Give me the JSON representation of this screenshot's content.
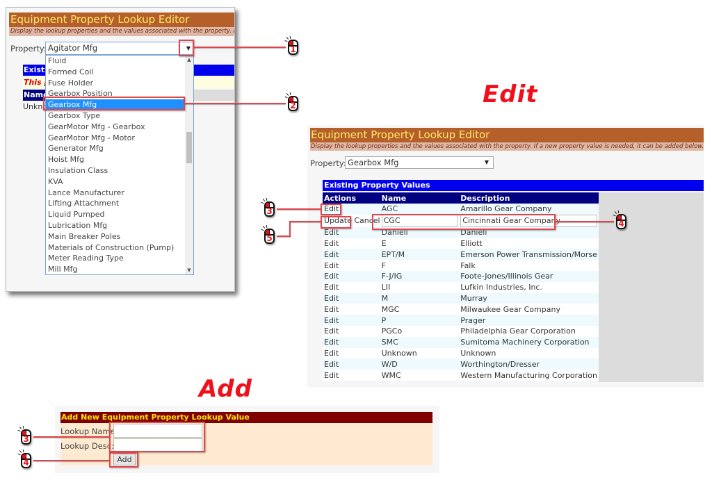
{
  "app": {
    "title": "Equipment Property Lookup Editor",
    "subtitle": "Display the lookup properties and the values associated with the property. If a new property value is needed, it can be added below.",
    "property_label": "Property:"
  },
  "labels": {
    "edit_heading": "Edit",
    "add_heading": "Add"
  },
  "dropdown_panel": {
    "selected_value": "Agitator Mfg",
    "dropdown_arrow": "▼",
    "bg_section_head": "Existing Property Values",
    "bg_warning": "This property has no values",
    "bg_name_header": "Name",
    "bg_first_value": "Unknown",
    "options": [
      "Fluid",
      "Formed Coil",
      "Fuse Holder",
      "Gearbox Position",
      "Gearbox Mfg",
      "Gearbox Type",
      "GearMotor Mfg - Gearbox",
      "GearMotor Mfg - Motor",
      "Generator Mfg",
      "Hoist Mfg",
      "Insulation Class",
      "KVA",
      "Lance Manufacturer",
      "Lifting Attachment",
      "Liquid Pumped",
      "Lubrication Mfg",
      "Main Breaker Poles",
      "Materials of Construction (Pump)",
      "Meter Reading Type",
      "Mill Mfg"
    ],
    "highlighted_option": "Gearbox Mfg"
  },
  "edit_panel": {
    "selected_value": "Gearbox Mfg",
    "dropdown_arrow": "▼",
    "section_head": "Existing Property Values",
    "columns": [
      "Actions",
      "Name",
      "Description"
    ],
    "edit_label": "Edit",
    "update_label": "Update",
    "cancel_label": "Cancel",
    "editing_row": {
      "name": "CGC",
      "description": "Cincinnati Gear Company"
    },
    "rows": [
      {
        "name": "AGC",
        "description": "Amarillo Gear Company"
      },
      {
        "name": "CGC",
        "description": "Cincinnati Gear Company",
        "editing": true
      },
      {
        "name": "Danieli",
        "description": "Danieli"
      },
      {
        "name": "E",
        "description": "Elliott"
      },
      {
        "name": "EPT/M",
        "description": "Emerson Power Transmission/Morse"
      },
      {
        "name": "F",
        "description": "Falk"
      },
      {
        "name": "F-J/IG",
        "description": "Foote-Jones/Illinois Gear"
      },
      {
        "name": "LII",
        "description": "Lufkin Industries, Inc."
      },
      {
        "name": "M",
        "description": "Murray"
      },
      {
        "name": "MGC",
        "description": "Milwaukee Gear Company"
      },
      {
        "name": "P",
        "description": "Prager"
      },
      {
        "name": "PGCo",
        "description": "Philadelphia Gear Corporation"
      },
      {
        "name": "SMC",
        "description": "Sumitoma Machinery Corporation"
      },
      {
        "name": "Unknown",
        "description": "Unknown"
      },
      {
        "name": "W/D",
        "description": "Worthington/Dresser"
      },
      {
        "name": "WMC",
        "description": "Western Manufacturing Corporation"
      }
    ]
  },
  "add_panel": {
    "heading": "Add New Equipment Property Lookup Value",
    "name_label": "Lookup Name:",
    "desc_label": "Lookup Desc:",
    "name_value": "",
    "desc_value": "",
    "add_button": "Add"
  },
  "callouts": {
    "step1": "1",
    "step2": "2",
    "edit_step3": "3",
    "edit_step4": "4",
    "edit_step5": "5",
    "add_step3": "3",
    "add_step4": "4"
  },
  "colors": {
    "title_bar": "#b5602a",
    "title_text": "#ffe96a",
    "section_head_blue": "#0000ee",
    "table_header_navy": "#000080",
    "add_head_maroon": "#800000",
    "add_body_peach": "#feead0",
    "callout_red": "#e0454b",
    "heading_red": "#f0101a"
  }
}
